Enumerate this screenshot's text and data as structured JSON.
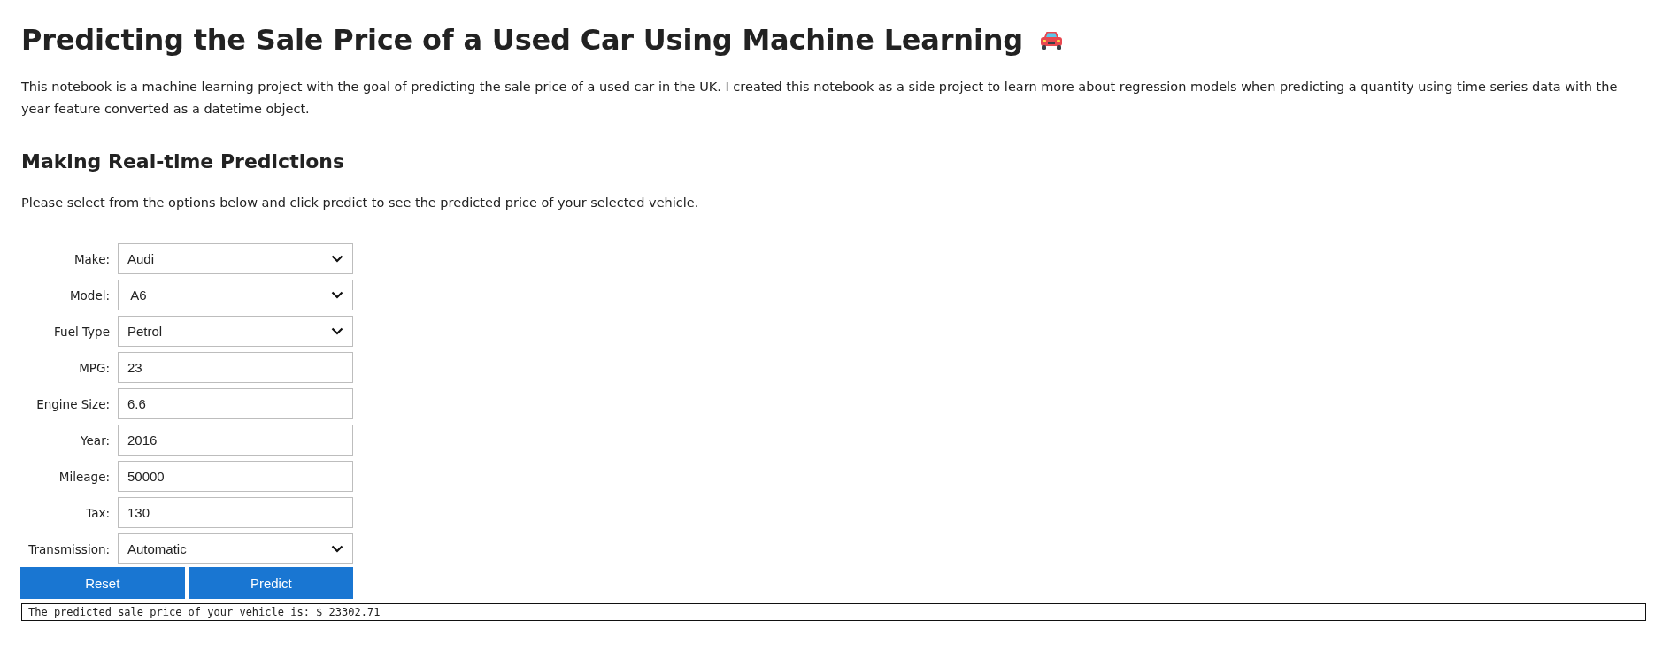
{
  "title": "Predicting the Sale Price of a Used Car Using Machine Learning",
  "intro": "This notebook is a machine learning project with the goal of predicting the sale price of a used car in the UK. I created this notebook as a side project to learn more about regression models when predicting a quantity using time series data with the year feature converted as a datetime object.",
  "section_heading": "Making Real-time Predictions",
  "instructions": "Please select from the options below and click predict to see the predicted price of your selected vehicle.",
  "form": {
    "fields": [
      {
        "label": "Make:",
        "kind": "select",
        "value": "Audi"
      },
      {
        "label": "Model:",
        "kind": "select",
        "value": " A6"
      },
      {
        "label": "Fuel Type",
        "kind": "select",
        "value": "Petrol"
      },
      {
        "label": "MPG:",
        "kind": "input",
        "value": "23"
      },
      {
        "label": "Engine Size:",
        "kind": "input",
        "value": "6.6"
      },
      {
        "label": "Year:",
        "kind": "input",
        "value": "2016"
      },
      {
        "label": "Mileage:",
        "kind": "input",
        "value": "50000"
      },
      {
        "label": "Tax:",
        "kind": "input",
        "value": "130"
      },
      {
        "label": "Transmission:",
        "kind": "select",
        "value": "Automatic"
      }
    ],
    "buttons": [
      "Reset",
      "Predict"
    ]
  },
  "output": "The predicted sale price of your vehicle is: $ 23302.71"
}
